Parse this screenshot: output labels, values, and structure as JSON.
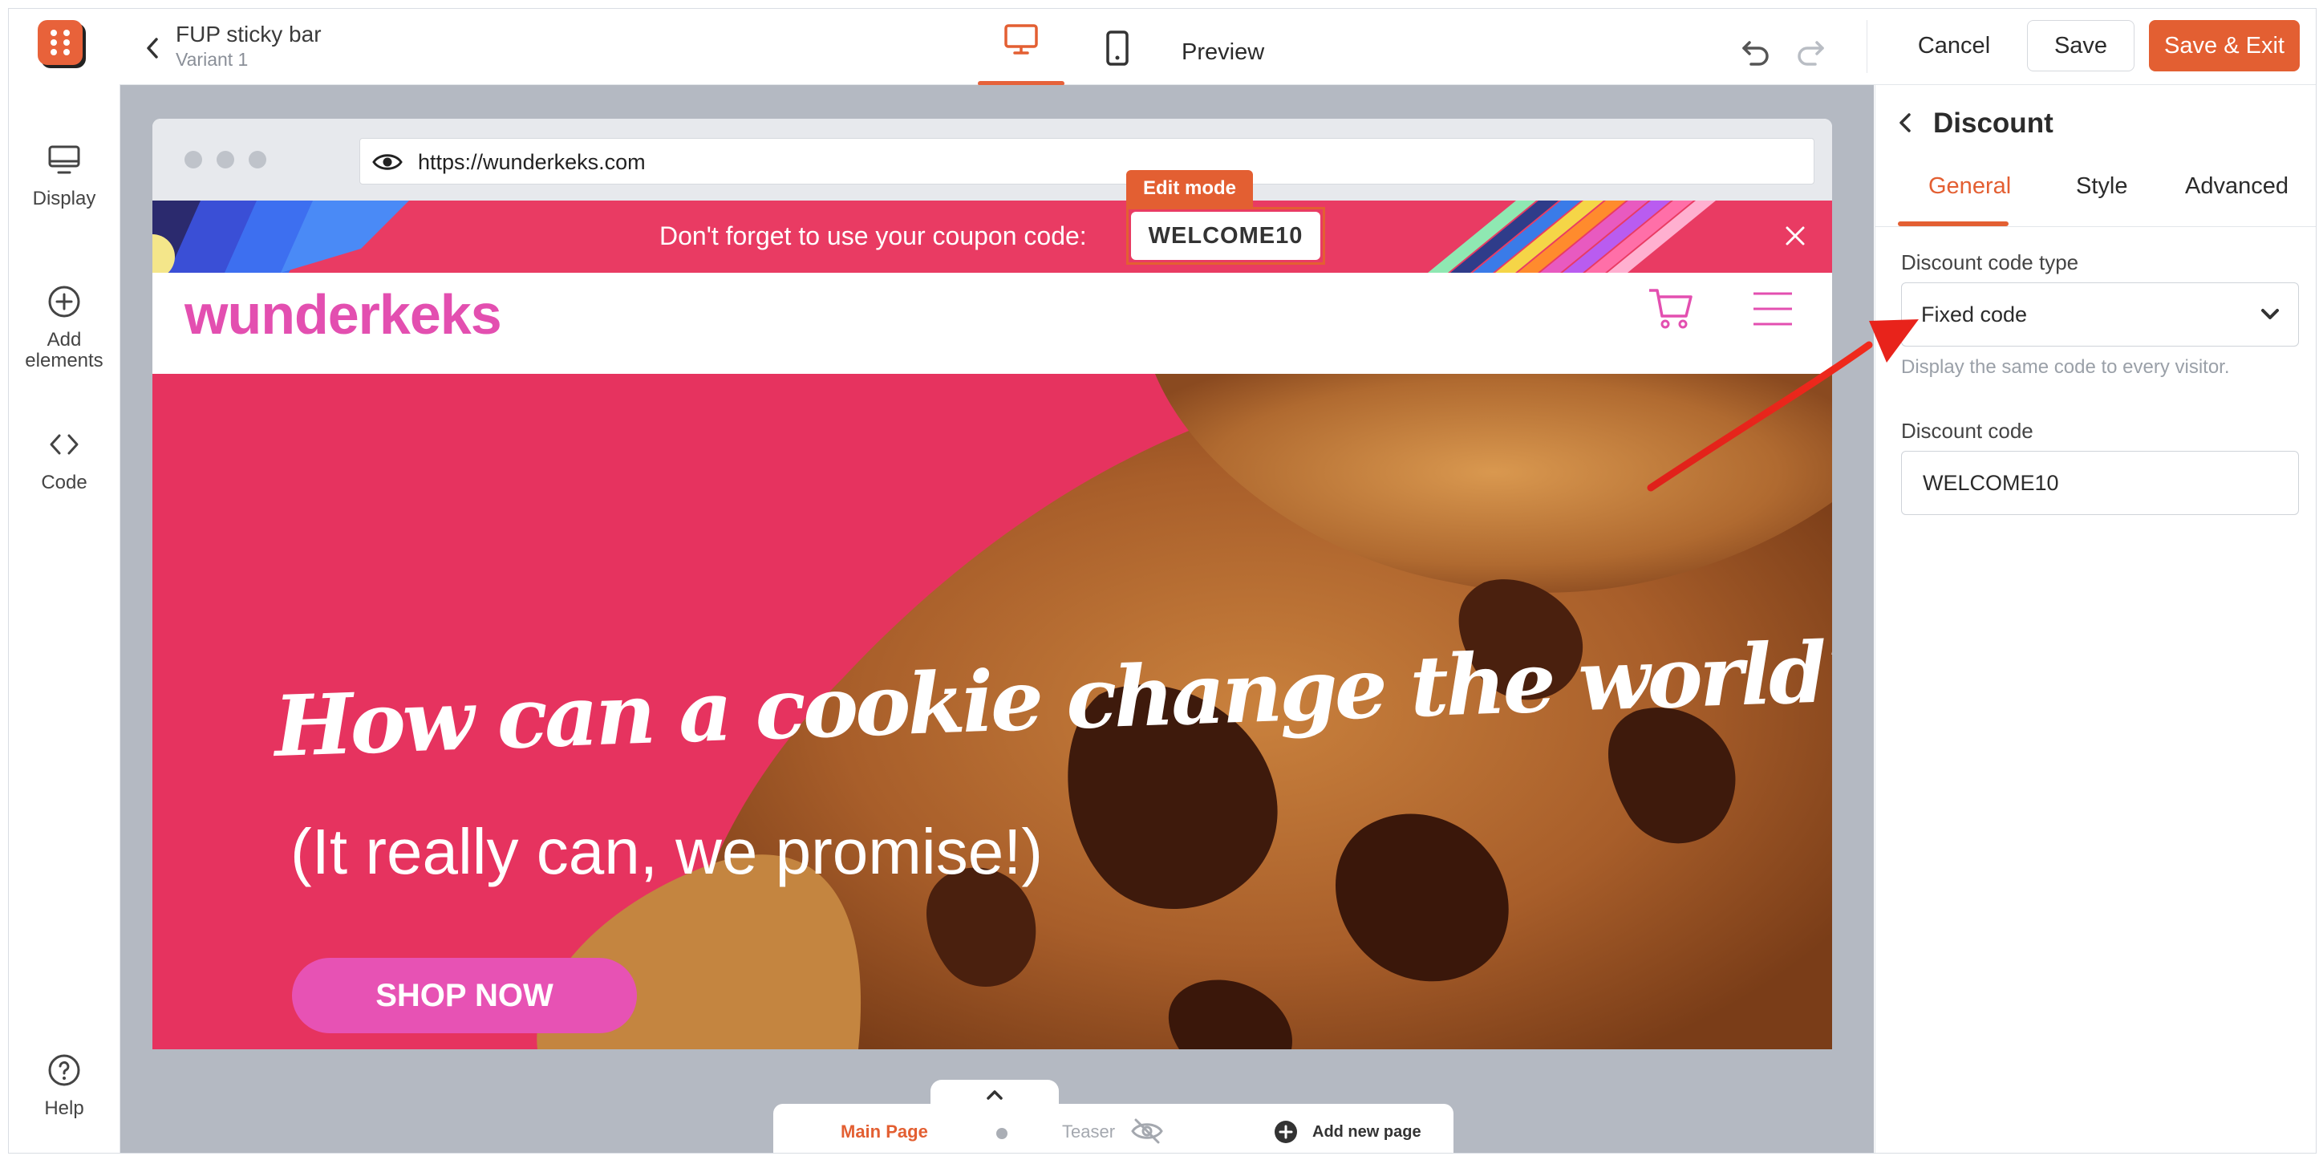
{
  "header": {
    "title": "FUP sticky bar",
    "subtitle": "Variant 1",
    "preview_label": "Preview",
    "cancel_label": "Cancel",
    "save_label": "Save",
    "save_exit_label": "Save & Exit",
    "accent_color": "#e35f32"
  },
  "sidebar": {
    "items": [
      {
        "label": "Display",
        "icon": "monitor-icon"
      },
      {
        "label": "Add\nelements",
        "icon": "plus-circle-icon"
      },
      {
        "label": "Code",
        "icon": "code-icon"
      },
      {
        "label": "Help",
        "icon": "help-icon"
      }
    ]
  },
  "browser": {
    "url": "https://wunderkeks.com"
  },
  "sticky_bar": {
    "edit_mode_label": "Edit mode",
    "text": "Don't forget to use your coupon code:",
    "coupon_code": "WELCOME10",
    "background": "#e93b63"
  },
  "site": {
    "brand": "wunderkeks",
    "headline": "How can a cookie change the world?",
    "subheadline": "(It really can, we promise!)",
    "cta": "SHOP NOW"
  },
  "pages": {
    "main": "Main Page",
    "teaser": "Teaser",
    "add": "Add new page"
  },
  "panel": {
    "title": "Discount",
    "tabs": [
      "General",
      "Style",
      "Advanced"
    ],
    "active_tab": "General",
    "code_type_label": "Discount code type",
    "code_type_value": "Fixed code",
    "code_type_helper": "Display the same code to every visitor.",
    "code_label": "Discount code",
    "code_value": "WELCOME10"
  }
}
